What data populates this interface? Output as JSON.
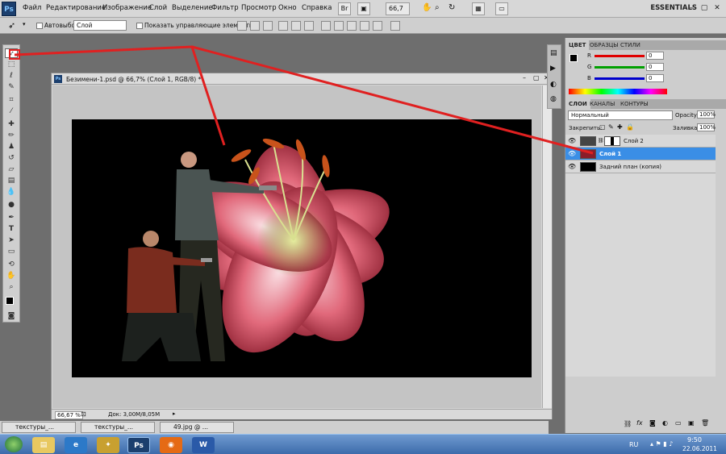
{
  "menubar": {
    "logo": "Ps",
    "items": [
      "Файл",
      "Редактирование",
      "Изображение",
      "Слой",
      "Выделение",
      "Фильтр",
      "Просмотр",
      "Окно",
      "Справка"
    ],
    "br_label": "Br",
    "zoom_value": "66,7",
    "workspace": "ESSENTIALS",
    "colors": {
      "bar": "#d7d7d7",
      "logo_bg": "#1c3f6e"
    }
  },
  "options": {
    "autoselect_label": "Автовыбор:",
    "autoselect_value": "Слой",
    "show_controls_label": "Показать управляющие элементы"
  },
  "document": {
    "title": "Безимени-1.psd @ 66,7% (Слой 1, RGB/8) *",
    "zoom": "66,67 %",
    "doc_size": "Док: 3,00M/8,05M"
  },
  "color_panel": {
    "tabs": [
      "ЦВЕТ",
      "ОБРАЗЦЫ",
      "СТИЛИ"
    ],
    "channels": [
      {
        "label": "R",
        "value": "0",
        "color": "#e00000"
      },
      {
        "label": "G",
        "value": "0",
        "color": "#00a000"
      },
      {
        "label": "B",
        "value": "0",
        "color": "#0000cc"
      }
    ]
  },
  "layers_panel": {
    "tabs": [
      "СЛОИ",
      "КАНАЛЫ",
      "КОНТУРЫ"
    ],
    "blend_mode": "Нормальный",
    "opacity_label": "Opacity:",
    "opacity_value": "100%",
    "lock_label": "Закрепить:",
    "fill_label": "Заливка:",
    "fill_value": "100%",
    "layers": [
      {
        "name": "Слой 2",
        "selected": false
      },
      {
        "name": "Слой 1",
        "selected": true
      },
      {
        "name": "Задний план (копия)",
        "selected": false
      }
    ],
    "selection_color": "#3a8ee6"
  },
  "task_buttons": [
    "текстуры_...",
    "текстуры_...",
    "49.jpg @ ..."
  ],
  "taskbar": {
    "lang": "RU",
    "time": "9:50",
    "date": "22.06.2011",
    "apps": [
      "explorer-icon",
      "ie-icon",
      "app-icon",
      "photoshop-icon",
      "firefox-icon",
      "word-icon"
    ]
  },
  "annotation_color": "#e02020"
}
